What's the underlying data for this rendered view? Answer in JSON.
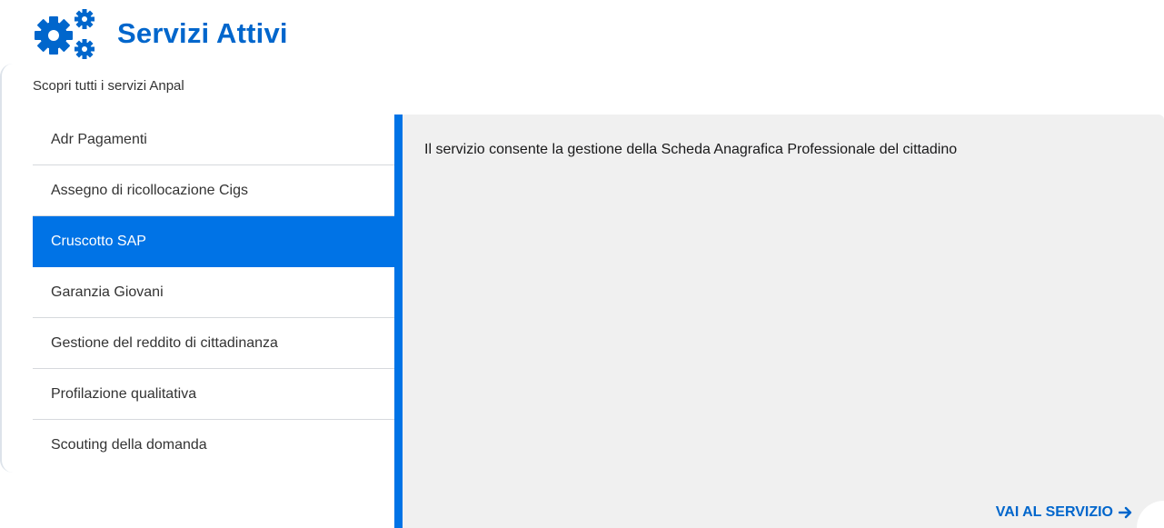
{
  "header": {
    "title": "Servizi Attivi",
    "icon": "gears-icon",
    "accent_color": "#0066cc"
  },
  "subtitle": "Scopri tutti i servizi Anpal",
  "menu": {
    "items": [
      {
        "label": "Adr Pagamenti",
        "active": false
      },
      {
        "label": "Assegno di ricollocazione Cigs",
        "active": false
      },
      {
        "label": "Cruscotto SAP",
        "active": true
      },
      {
        "label": "Garanzia Giovani",
        "active": false
      },
      {
        "label": "Gestione del reddito di cittadinanza",
        "active": false
      },
      {
        "label": "Profilazione qualitativa",
        "active": false
      },
      {
        "label": "Scouting della domanda",
        "active": false
      }
    ],
    "active_color": "#0073e6"
  },
  "panel": {
    "description": "Il servizio consente la gestione della Scheda Anagrafica Professionale del cittadino",
    "cta_label": "VAI AL SERVIZIO",
    "cta_icon": "arrow-right-icon",
    "background": "#f0f0f0"
  }
}
